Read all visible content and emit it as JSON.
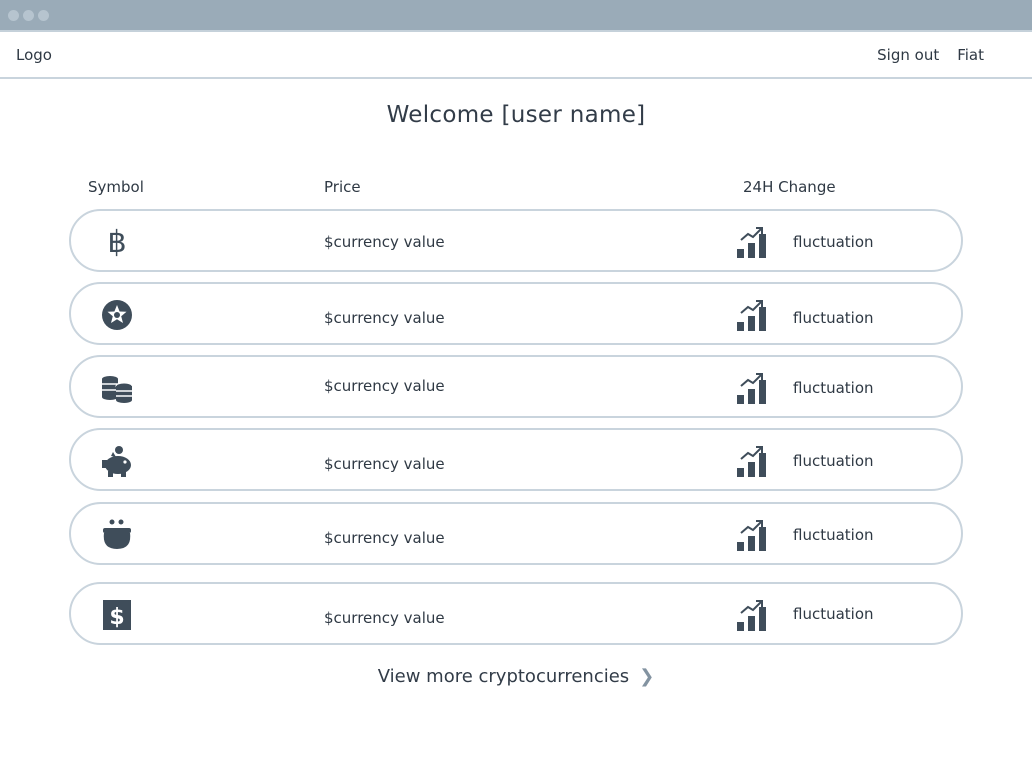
{
  "window": {
    "title_dots": 3
  },
  "nav": {
    "logo": "Logo",
    "sign_out": "Sign out",
    "fiat": "Fiat"
  },
  "welcome": "Welcome [user name]",
  "table": {
    "headers": {
      "symbol": "Symbol",
      "price": "Price",
      "change": "24H Change"
    },
    "rows": [
      {
        "icon": "bitcoin-icon",
        "price": "$currency value",
        "change": "fluctuation"
      },
      {
        "icon": "badge-star-icon",
        "price": "$currency value",
        "change": "fluctuation"
      },
      {
        "icon": "coin-stacks-icon",
        "price": "$currency value",
        "change": "fluctuation"
      },
      {
        "icon": "piggy-bank-icon",
        "price": "$currency value",
        "change": "fluctuation"
      },
      {
        "icon": "coin-purse-icon",
        "price": "$currency value",
        "change": "fluctuation"
      },
      {
        "icon": "dollar-bill-icon",
        "price": "$currency value",
        "change": "fluctuation"
      }
    ]
  },
  "view_more": "View more cryptocurrencies",
  "colors": {
    "icon": "#3f4d5a",
    "border": "#c9d4dd",
    "titlebar": "#9aabb8"
  }
}
